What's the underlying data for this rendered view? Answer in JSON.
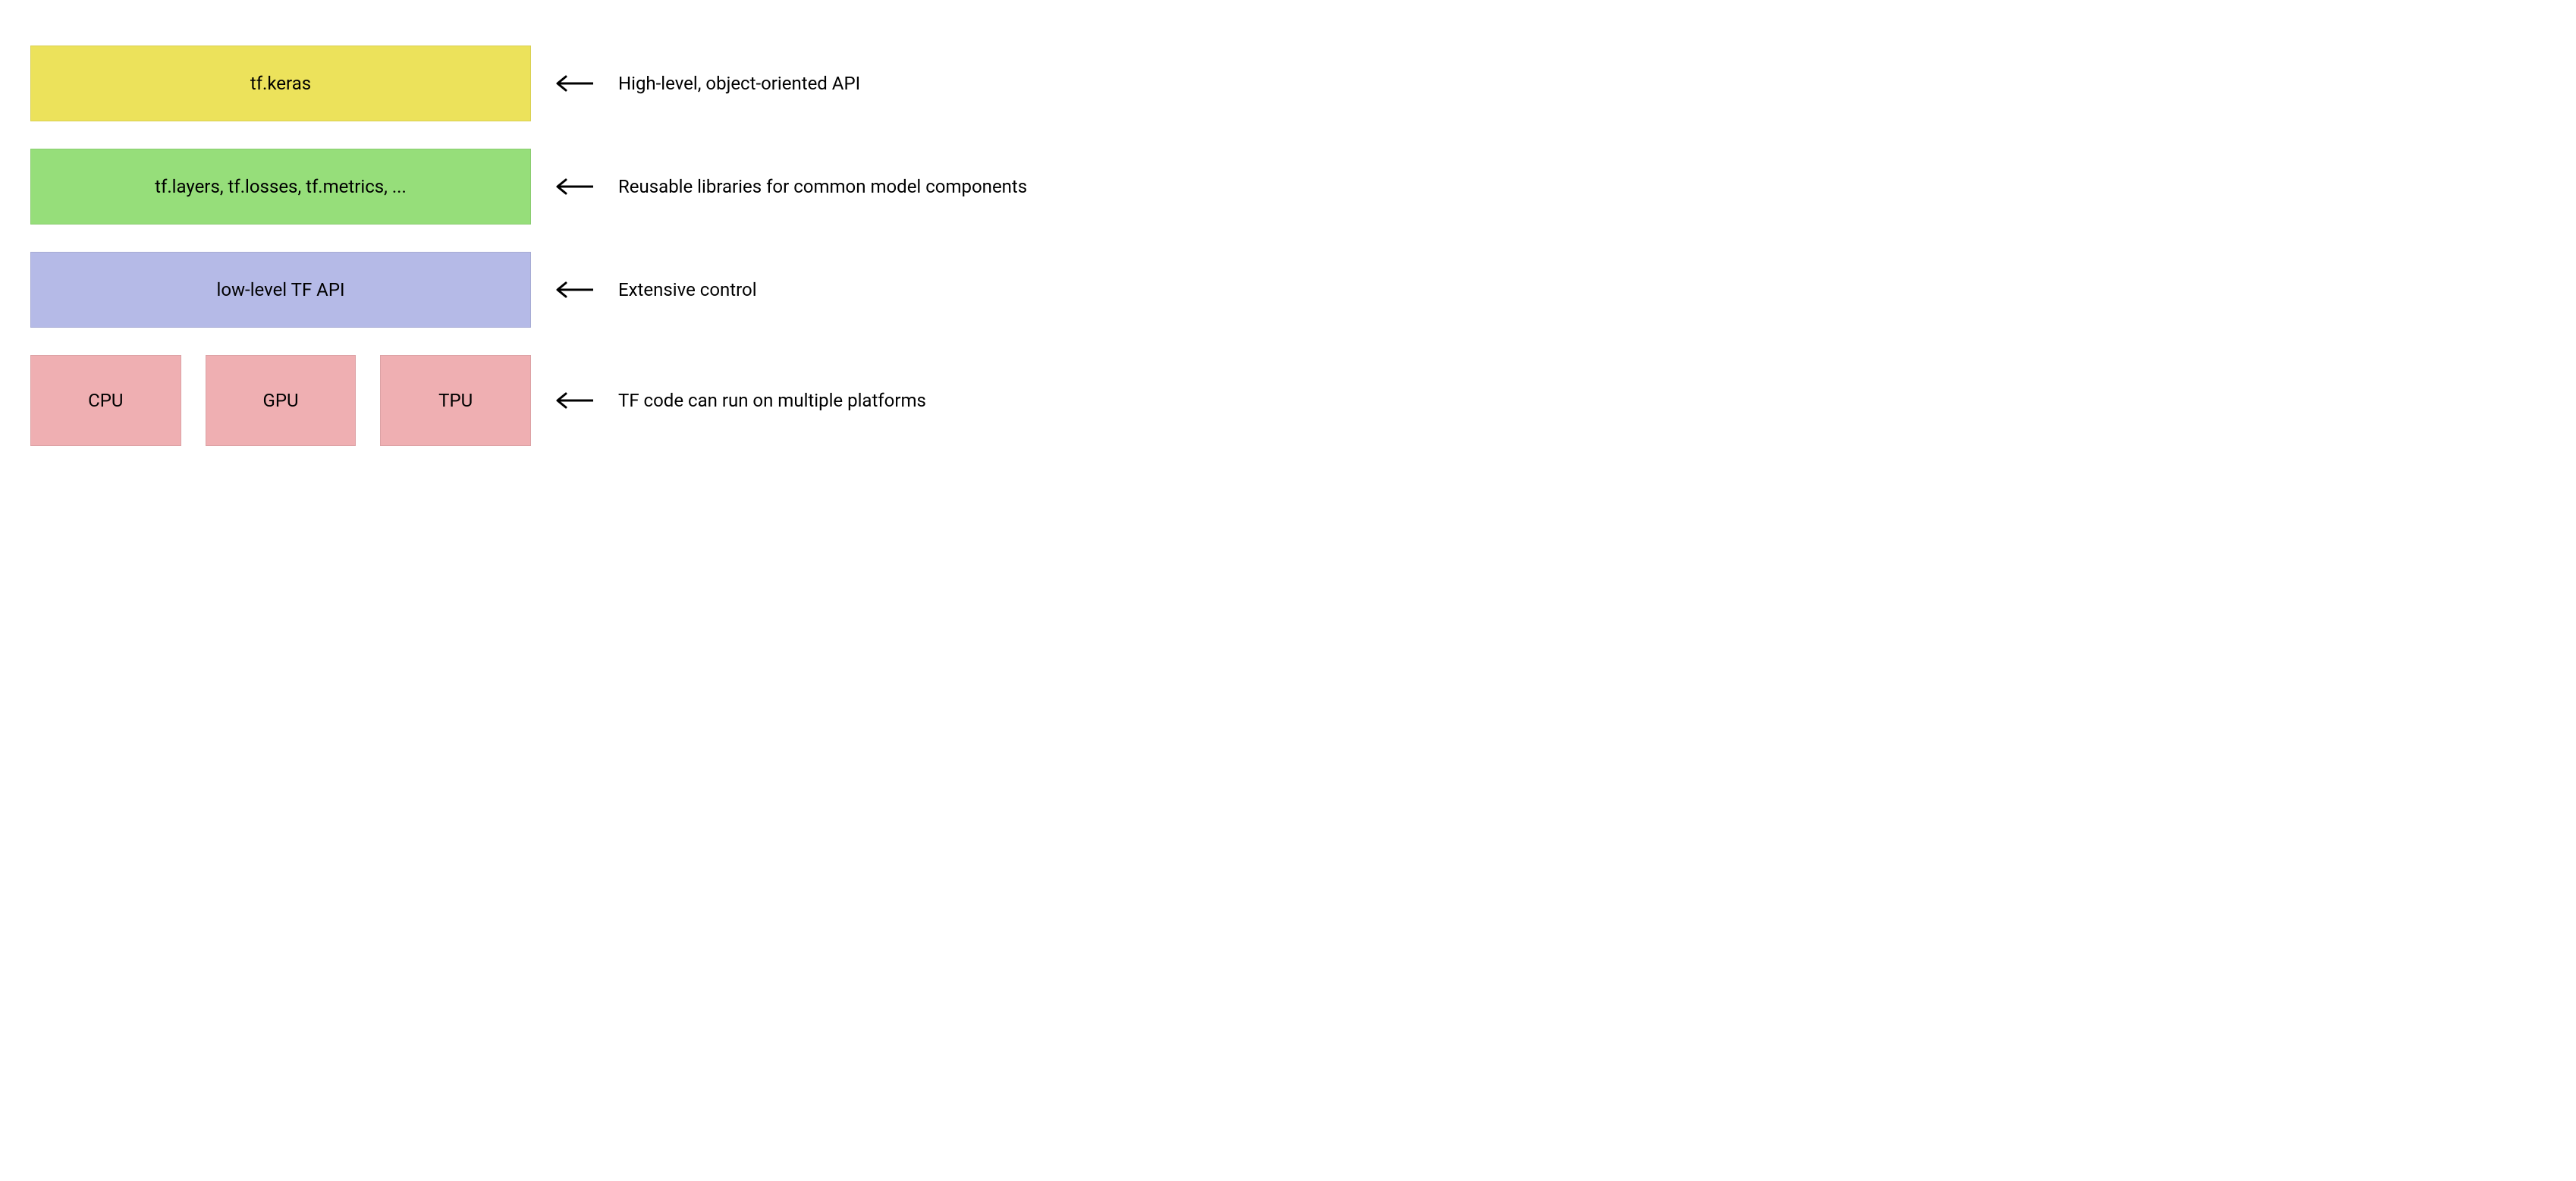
{
  "layers": [
    {
      "label": "tf.keras",
      "description": "High-level, object-oriented API",
      "color": "yellow",
      "split": false
    },
    {
      "label": "tf.layers, tf.losses, tf.metrics, ...",
      "description": "Reusable libraries for common model components",
      "color": "green",
      "split": false
    },
    {
      "label": "low-level TF API",
      "description": "Extensive control",
      "color": "blue",
      "split": false
    },
    {
      "labels": [
        "CPU",
        "GPU",
        "TPU"
      ],
      "description": "TF code can run on multiple platforms",
      "color": "pink",
      "split": true
    }
  ]
}
